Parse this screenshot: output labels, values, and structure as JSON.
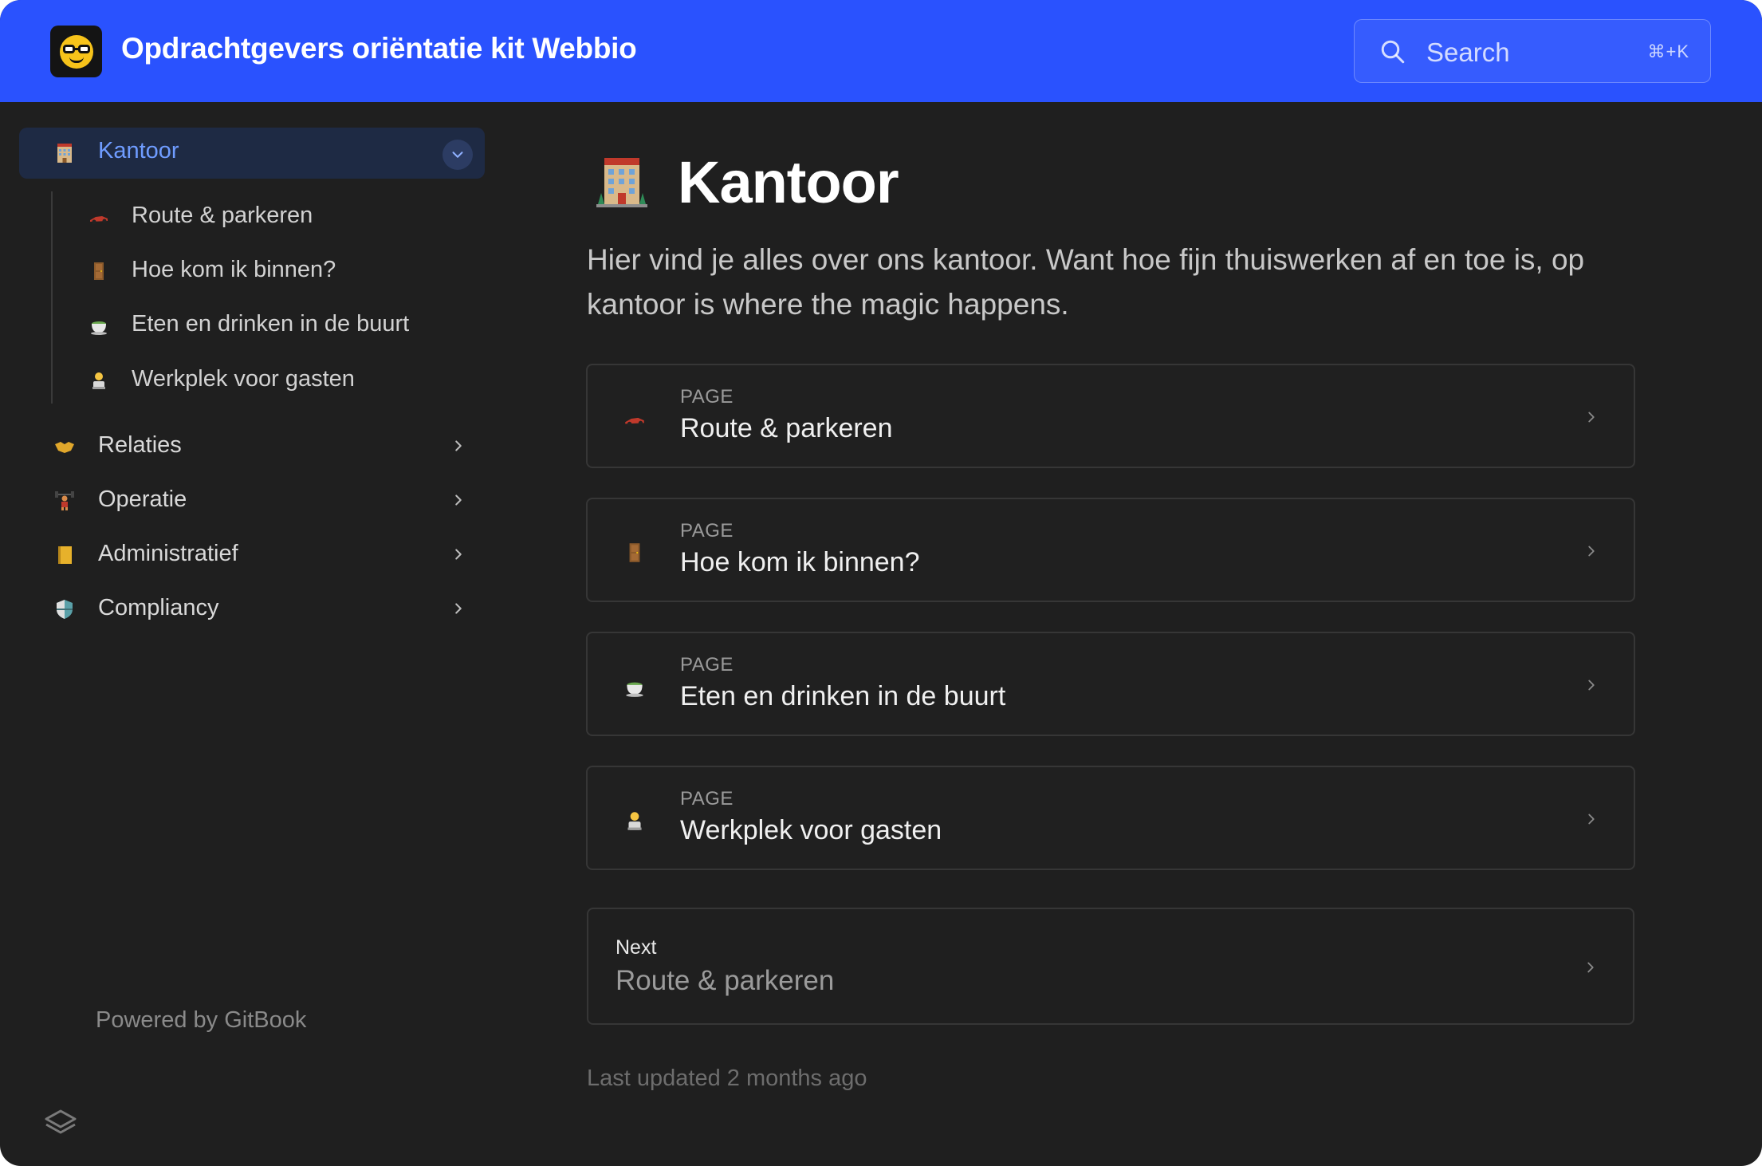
{
  "header": {
    "title": "Opdrachtgevers oriëntatie kit Webbio",
    "logo_icon": "nerd-face-icon",
    "search": {
      "placeholder": "Search",
      "shortcut": "⌘+K"
    },
    "accent_color": "#2a52fe"
  },
  "sidebar": {
    "groups": [
      {
        "label": "Kantoor",
        "icon": "hotel-icon",
        "expanded": true,
        "active": true,
        "children": [
          {
            "label": "Route & parkeren",
            "icon": "race-car-icon"
          },
          {
            "label": "Hoe kom ik binnen?",
            "icon": "door-icon"
          },
          {
            "label": "Eten en drinken in de buurt",
            "icon": "tea-cup-icon"
          },
          {
            "label": "Werkplek voor gasten",
            "icon": "person-at-computer-icon"
          }
        ]
      },
      {
        "label": "Relaties",
        "icon": "handshake-icon",
        "expanded": false
      },
      {
        "label": "Operatie",
        "icon": "weightlifter-icon",
        "expanded": false
      },
      {
        "label": "Administratief",
        "icon": "ledger-icon",
        "expanded": false
      },
      {
        "label": "Compliancy",
        "icon": "shield-icon",
        "expanded": false
      }
    ],
    "powered_by": "Powered by GitBook"
  },
  "main": {
    "title": "Kantoor",
    "title_icon": "hotel-icon",
    "description": "Hier vind je alles over ons kantoor. Want hoe fijn thuiswerken af en toe is, op kantoor is where the magic happens.",
    "cards": [
      {
        "kicker": "PAGE",
        "title": "Route & parkeren",
        "icon": "race-car-icon"
      },
      {
        "kicker": "PAGE",
        "title": "Hoe kom ik binnen?",
        "icon": "door-icon"
      },
      {
        "kicker": "PAGE",
        "title": "Eten en drinken in de buurt",
        "icon": "tea-cup-icon"
      },
      {
        "kicker": "PAGE",
        "title": "Werkplek voor gasten",
        "icon": "person-at-computer-icon"
      }
    ],
    "next": {
      "kicker": "Next",
      "title": "Route & parkeren"
    },
    "last_updated": "Last updated 2 months ago"
  }
}
